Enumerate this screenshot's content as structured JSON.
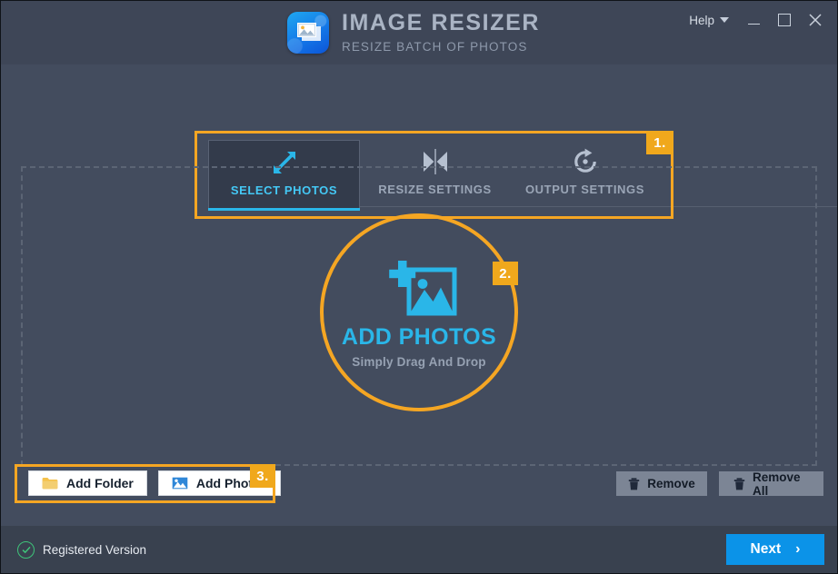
{
  "window": {
    "help_label": "Help",
    "minimize_label": "Minimize",
    "maximize_label": "Maximize",
    "close_label": "Close"
  },
  "brand": {
    "title": "IMAGE RESIZER",
    "subtitle": "RESIZE BATCH OF PHOTOS",
    "icon": "photo-stack-icon"
  },
  "tabs": [
    {
      "label": "SELECT PHOTOS",
      "icon": "resize-arrows-icon",
      "active": true
    },
    {
      "label": "RESIZE SETTINGS",
      "icon": "mirror-flip-icon",
      "active": false
    },
    {
      "label": "OUTPUT SETTINGS",
      "icon": "refresh-circle-icon",
      "active": false
    }
  ],
  "dropzone": {
    "title": "ADD PHOTOS",
    "subtitle": "Simply Drag And Drop",
    "icon": "add-image-icon"
  },
  "actions": {
    "add_folder": "Add Folder",
    "add_photos": "Add Photos",
    "remove": "Remove",
    "remove_all": "Remove All",
    "folder_icon": "folder-icon",
    "photos_icon": "image-icon",
    "trash_icon": "trash-icon"
  },
  "footer": {
    "registered": "Registered Version",
    "next": "Next",
    "next_arrow": "›",
    "check_icon": "check-circle-icon"
  },
  "callouts": [
    {
      "id": "1",
      "label": "1."
    },
    {
      "id": "2",
      "label": "2."
    },
    {
      "id": "3",
      "label": "3."
    }
  ],
  "colors": {
    "background": "#434c5e",
    "titlebar": "#3e4657",
    "footer": "#39414f",
    "accent_orange": "#f5a623",
    "accent_cyan": "#2ab6e8",
    "accent_blue": "#0b93e8",
    "registered_green": "#3ec47a"
  }
}
